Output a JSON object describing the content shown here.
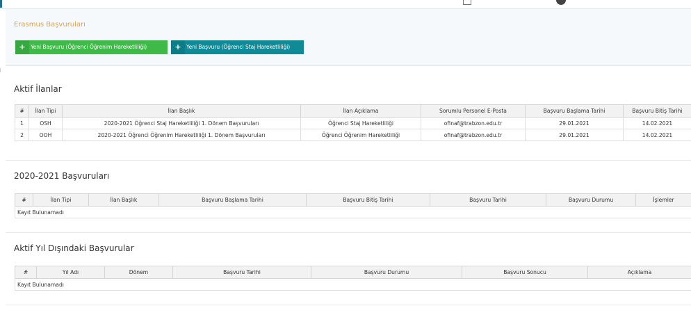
{
  "page": {
    "title": "Erasmus Başvuruları"
  },
  "buttons": {
    "new_study": "Yeni Başvuru (Öğrenci Öğrenim Hareketliliği)",
    "new_internship": "Yeni Başvuru (Öğrenci Staj Hareketliliği)"
  },
  "active_listings": {
    "title": "Aktif İlanlar",
    "columns": [
      "#",
      "İlan Tipi",
      "İlan Başlık",
      "İlan Açıklama",
      "Sorumlu Personel E-Posta",
      "Başvuru Başlama Tarihi",
      "Başvuru Bitiş Tarihi"
    ],
    "rows": [
      [
        "1",
        "OSH",
        "2020-2021 Öğrenci Staj Hareketliliği 1. Dönem Başvuruları",
        "Öğrenci Staj Hareketliliği",
        "ofinaf@trabzon.edu.tr",
        "29.01.2021",
        "14.02.2021"
      ],
      [
        "2",
        "OOH",
        "2020-2021 Öğrenci Öğrenim Hareketliliği 1. Dönem Başvuruları",
        "Öğrenci Öğrenim Hareketliliği",
        "ofinaf@trabzon.edu.tr",
        "29.01.2021",
        "14.02.2021"
      ]
    ]
  },
  "applications_2020": {
    "title": "2020-2021 Başvuruları",
    "columns": [
      "#",
      "İlan Tipi",
      "İlan Başlık",
      "Başvuru Başlama Tarihi",
      "Başvuru Bitiş Tarihi",
      "Başvuru Tarihi",
      "Başvuru Durumu",
      "İşlemler"
    ],
    "empty": "Kayıt Bulunamadı"
  },
  "other_years": {
    "title": "Aktif Yıl Dışındaki Başvurular",
    "columns": [
      "#",
      "Yıl Adı",
      "Dönem",
      "Başvuru Tarihi",
      "Başvuru Durumu",
      "Başvuru Sonucu",
      "Açıklama"
    ],
    "empty": "Kayıt Bulunamadı"
  },
  "colors": {
    "title_orange": "#e7a33b",
    "btn_green": "#3fba49",
    "btn_teal": "#0f8a96"
  },
  "icons": {
    "button_icon": "plus-icon",
    "top_icon_1": "document-icon",
    "top_icon_2": "user-avatar-icon"
  }
}
